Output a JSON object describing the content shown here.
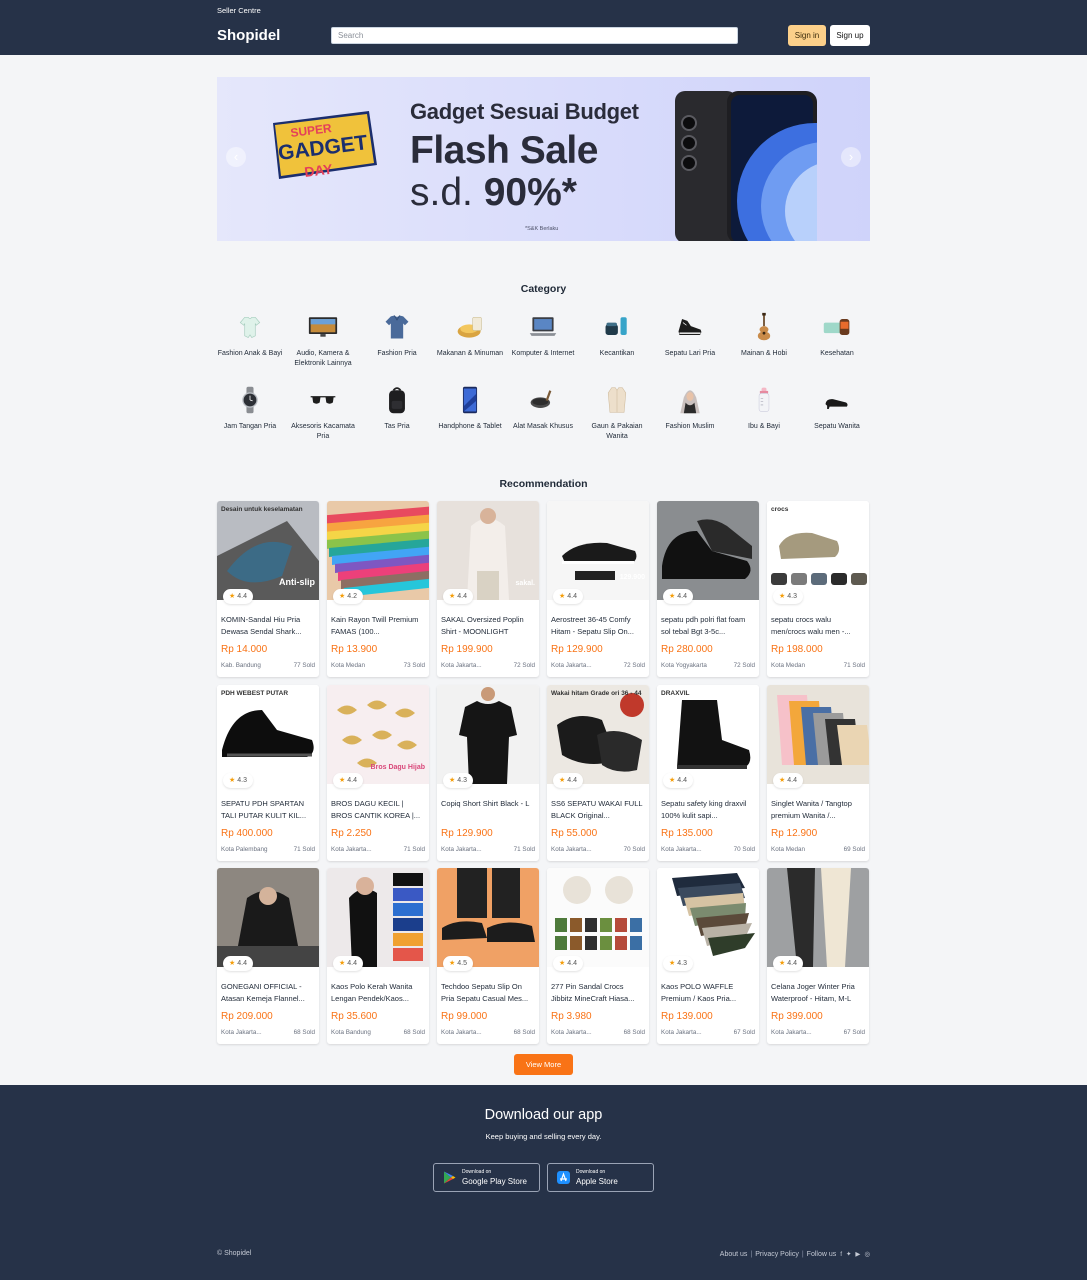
{
  "header": {
    "seller_centre": "Seller Centre",
    "logo": "Shopidel",
    "search_placeholder": "Search",
    "sign_in": "Sign in",
    "sign_up": "Sign up"
  },
  "banner": {
    "logo_lines": [
      "SUPER",
      "GADGET",
      "DAY"
    ],
    "headline": "Gadget Sesuai Budget",
    "sale": "Flash Sale",
    "discount_prefix": "s.d. ",
    "discount": "90%*",
    "note": "*S&K Berlaku",
    "slides": 3
  },
  "category": {
    "title": "Category",
    "items": [
      {
        "label": "Fashion Anak & Bayi",
        "icon": "baby-onesie-icon"
      },
      {
        "label": "Audio, Kamera & Elektronik Lainnya",
        "icon": "tv-icon"
      },
      {
        "label": "Fashion Pria",
        "icon": "shirt-icon"
      },
      {
        "label": "Makanan & Minuman",
        "icon": "food-icon"
      },
      {
        "label": "Komputer & Internet",
        "icon": "laptop-icon"
      },
      {
        "label": "Kecantikan",
        "icon": "cosmetics-icon"
      },
      {
        "label": "Sepatu Lari Pria",
        "icon": "sneaker-icon"
      },
      {
        "label": "Mainan & Hobi",
        "icon": "guitar-icon"
      },
      {
        "label": "Kesehatan",
        "icon": "health-icon"
      },
      {
        "label": "Jam Tangan Pria",
        "icon": "watch-icon"
      },
      {
        "label": "Aksesoris Kacamata Pria",
        "icon": "sunglasses-icon"
      },
      {
        "label": "Tas Pria",
        "icon": "backpack-icon"
      },
      {
        "label": "Handphone & Tablet",
        "icon": "phone-icon"
      },
      {
        "label": "Alat Masak Khusus",
        "icon": "pan-icon"
      },
      {
        "label": "Gaun & Pakaian Wanita",
        "icon": "coat-icon"
      },
      {
        "label": "Fashion Muslim",
        "icon": "hijab-icon"
      },
      {
        "label": "Ibu & Bayi",
        "icon": "bottle-icon"
      },
      {
        "label": "Sepatu Wanita",
        "icon": "heel-shoe-icon"
      }
    ]
  },
  "recommendation": {
    "title": "Recommendation",
    "products": [
      {
        "name": "KOMIN-Sandal Hiu Pria Dewasa Sendal Shark...",
        "price": "Rp 14.000",
        "rating": "4.4",
        "location": "Kab. Bandung",
        "sold": "77 Sold",
        "img_text": "Desain untuk keselamatan",
        "img_text2": "Anti-slip",
        "bg": "#b9bcc2",
        "fg": "#3c6b86"
      },
      {
        "name": "Kain Rayon Twill Premium FAMAS (100...",
        "price": "Rp 13.900",
        "rating": "4.2",
        "location": "Kota Medan",
        "sold": "73 Sold",
        "img_text": "",
        "img_text2": "",
        "bg": "#e9c9a8",
        "fg": "#c2455b"
      },
      {
        "name": "SAKAL Oversized Poplin Shirt - MOONLIGHT",
        "price": "Rp 199.900",
        "rating": "4.4",
        "location": "Kota Jakarta...",
        "sold": "72 Sold",
        "img_text": "",
        "img_text2": "sakal.",
        "bg": "#e7e1dc",
        "fg": "#f3eeea"
      },
      {
        "name": "Aerostreet 36-45 Comfy Hitam - Sepatu Slip On...",
        "price": "Rp 129.900",
        "rating": "4.4",
        "location": "Kota Jakarta...",
        "sold": "72 Sold",
        "img_text": "",
        "img_text2": "129.900",
        "bg": "#f6f6f6",
        "fg": "#1a1a1a"
      },
      {
        "name": "sepatu pdh polri flat foam sol tebal Bgt 3-5c...",
        "price": "Rp 280.000",
        "rating": "4.4",
        "location": "Kota Yogyakarta",
        "sold": "72 Sold",
        "img_text": "",
        "img_text2": "",
        "bg": "#8a8d90",
        "fg": "#111111"
      },
      {
        "name": "sepatu crocs walu men/crocs walu men -...",
        "price": "Rp 198.000",
        "rating": "4.3",
        "location": "Kota Medan",
        "sold": "71 Sold",
        "img_text": "crocs",
        "img_text2": "",
        "bg": "#ffffff",
        "fg": "#a59a7e"
      },
      {
        "name": "SEPATU PDH SPARTAN TALI PUTAR KULIT KIL...",
        "price": "Rp 400.000",
        "rating": "4.3",
        "location": "Kota Palembang",
        "sold": "71 Sold",
        "img_text": "PDH WEBEST PUTAR",
        "img_text2": "",
        "bg": "#ffffff",
        "fg": "#0d0d0d"
      },
      {
        "name": "BROS DAGU KECIL | BROS CANTIK KOREA |...",
        "price": "Rp 2.250",
        "rating": "4.4",
        "location": "Kota Jakarta...",
        "sold": "71 Sold",
        "img_text": "",
        "img_text2": "Bros Dagu Hijab",
        "bg": "#f7eef0",
        "fg": "#d9b15a"
      },
      {
        "name": "Copiq Short Shirt Black - L",
        "price": "Rp 129.900",
        "rating": "4.3",
        "location": "Kota Jakarta...",
        "sold": "71 Sold",
        "img_text": "",
        "img_text2": "",
        "bg": "#f2f2f2",
        "fg": "#151515"
      },
      {
        "name": "SS6 SEPATU WAKAI FULL BLACK Original...",
        "price": "Rp 55.000",
        "rating": "4.4",
        "location": "Kota Jakarta...",
        "sold": "70 Sold",
        "img_text": "Wakai hitam Grade ori 36 - 44",
        "img_text2": "",
        "bg": "#ece8e2",
        "fg": "#1b1b1b"
      },
      {
        "name": "Sepatu safety king draxvil 100% kulit sapi...",
        "price": "Rp 135.000",
        "rating": "4.4",
        "location": "Kota Jakarta...",
        "sold": "70 Sold",
        "img_text": "DRAXVIL",
        "img_text2": "",
        "bg": "#ffffff",
        "fg": "#121212"
      },
      {
        "name": "Singlet Wanita / Tangtop premium Wanita /...",
        "price": "Rp 12.900",
        "rating": "4.4",
        "location": "Kota Medan",
        "sold": "69 Sold",
        "img_text": "",
        "img_text2": "",
        "bg": "#e8e3da",
        "fg": "#c79d6e"
      },
      {
        "name": "GONEGANI OFFICIAL - Atasan Kemeja Flannel...",
        "price": "Rp 209.000",
        "rating": "4.4",
        "location": "Kota Jakarta...",
        "sold": "68 Sold",
        "img_text": "",
        "img_text2": "",
        "bg": "#8d8780",
        "fg": "#1a1a1a"
      },
      {
        "name": "Kaos Polo Kerah Wanita Lengan Pendek/Kaos...",
        "price": "Rp 35.600",
        "rating": "4.4",
        "location": "Kota Bandung",
        "sold": "68 Sold",
        "img_text": "",
        "img_text2": "",
        "bg": "#ede9ea",
        "fg": "#111111"
      },
      {
        "name": "Techdoo Sepatu Slip On Pria Sepatu Casual Mes...",
        "price": "Rp 99.000",
        "rating": "4.5",
        "location": "Kota Jakarta...",
        "sold": "68 Sold",
        "img_text": "",
        "img_text2": "",
        "bg": "#f0a165",
        "fg": "#1c1c1c"
      },
      {
        "name": "277 Pin Sandal Crocs Jibbitz MineCraft Hiasa...",
        "price": "Rp 3.980",
        "rating": "4.4",
        "location": "Kota Jakarta...",
        "sold": "68 Sold",
        "img_text": "",
        "img_text2": "",
        "bg": "#fbfbfb",
        "fg": "#4e7a3b"
      },
      {
        "name": "Kaos POLO WAFFLE Premium / Kaos Pria...",
        "price": "Rp 139.000",
        "rating": "4.3",
        "location": "Kota Jakarta...",
        "sold": "67 Sold",
        "img_text": "",
        "img_text2": "",
        "bg": "#ffffff",
        "fg": "#5b4a3a"
      },
      {
        "name": "Celana Joger Winter Pria Waterproof - Hitam, M-L",
        "price": "Rp 399.000",
        "rating": "4.4",
        "location": "Kota Jakarta...",
        "sold": "67 Sold",
        "img_text": "",
        "img_text2": "",
        "bg": "#9ea0a2",
        "fg": "#2b2b2b"
      }
    ],
    "view_more": "View More"
  },
  "footer": {
    "title": "Download our app",
    "subtitle": "Keep buying and selling every day.",
    "stores": [
      {
        "small": "Download on",
        "big": "Google Play Store",
        "icon": "google-play-icon"
      },
      {
        "small": "Download on",
        "big": "Apple Store",
        "icon": "app-store-icon"
      }
    ],
    "copyright": "© Shopidel",
    "links": [
      "About us",
      "Privacy Policy",
      "Follow us"
    ],
    "social_icons": [
      "facebook-icon",
      "twitter-icon",
      "youtube-icon",
      "instagram-icon"
    ]
  },
  "colors": {
    "navy": "#263248",
    "accent_orange": "#f97316",
    "sign_in_bg": "#fcd08a",
    "star": "#f59e0b"
  }
}
